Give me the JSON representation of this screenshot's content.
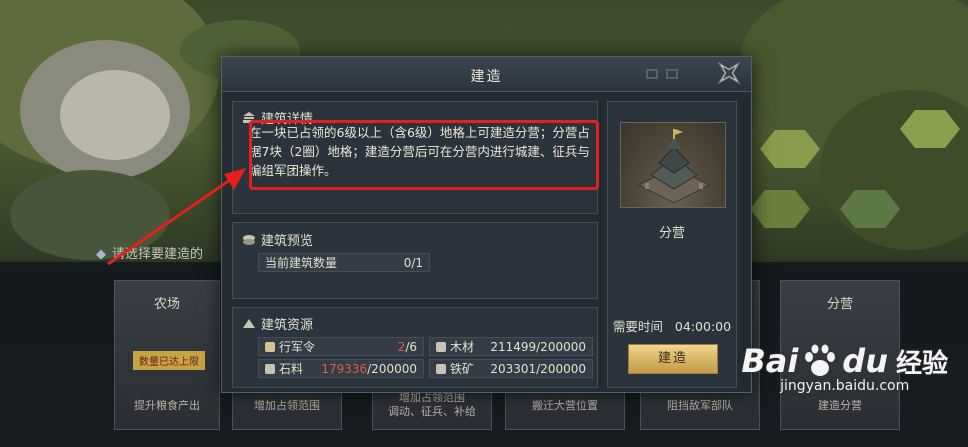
{
  "dialog": {
    "title": "建造",
    "detail": {
      "title": "建筑详情",
      "text": "在一块已占领的6级以上（含6级）地格上可建造分营；分营占据7块（2圈）地格；建造分营后可在分营内进行城建、征兵与编组军团操作。"
    },
    "preview": {
      "title": "建筑预览",
      "count_label": "当前建筑数量",
      "count_value": "0/1"
    },
    "resources": {
      "title": "建筑资源",
      "items": [
        {
          "label": "行军令",
          "current": "2",
          "total": "/6",
          "current_color": "#e05a4e"
        },
        {
          "label": "木材",
          "current": "211499",
          "total": "/200000",
          "current_color": "#e3dfd2"
        },
        {
          "label": "石料",
          "current": "179336",
          "total": "/200000",
          "current_color": "#e05a4e"
        },
        {
          "label": "铁矿",
          "current": "203301",
          "total": "/200000",
          "current_color": "#e3dfd2"
        }
      ]
    },
    "building": {
      "name": "分营",
      "time_label": "需要时间",
      "time_value": "04:00:00",
      "build_button": "建造"
    }
  },
  "background": {
    "prompt": "请选择要建造的",
    "cards": [
      {
        "title": "农场",
        "badge": "数量已达上限",
        "desc": "提升粮食产出"
      },
      {
        "title": "",
        "desc": "增加占领范围"
      },
      {
        "title": "",
        "desc": "增加占领范围\n调动、征兵、补给"
      },
      {
        "title": "",
        "desc": "搬迁大营位置"
      },
      {
        "title": "",
        "desc": "阻挡敌军部队"
      },
      {
        "title": "分营",
        "desc": "建造分营"
      }
    ]
  },
  "watermark": {
    "brand": "Bai",
    "brand2": "du",
    "suffix": "经验",
    "url": "jingyan.baidu.com"
  }
}
